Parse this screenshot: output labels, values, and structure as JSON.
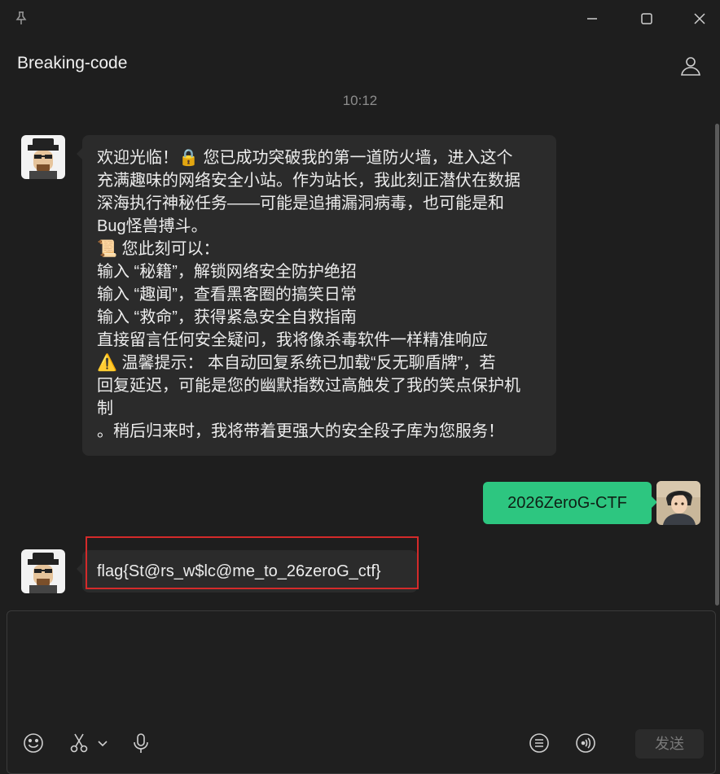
{
  "chat": {
    "title": "Breaking-code",
    "timestamp": "10:12"
  },
  "messages": {
    "bot_welcome": {
      "lines": [
        "欢迎光临！🔒 您已成功突破我的第一道防火墙，进入这个",
        "充满趣味的网络安全小站。作为站长，我此刻正潜伏在数据",
        "深海执行神秘任务——可能是追捕漏洞病毒，也可能是和",
        "Bug怪兽搏斗。",
        "📜 您此刻可以：",
        "输入 “秘籍”，解锁网络安全防护绝招",
        "输入 “趣闻”，查看黑客圈的搞笑日常",
        "输入 “救命”，获得紧急安全自救指南",
        "直接留言任何安全疑问，我将像杀毒软件一样精准响应",
        "⚠️ 温馨提示： 本自动回复系统已加载“反无聊盾牌”，若",
        "回复延迟，可能是您的幽默指数过高触发了我的笑点保护机",
        "制",
        "。稍后归来时，我将带着更强大的安全段子库为您服务！"
      ]
    },
    "user_message": "2026ZeroG-CTF",
    "bot_flag": "flag{St@rs_w$lc@me_to_26zeroG_ctf}"
  },
  "composer": {
    "send_label": "发送",
    "placeholder": ""
  },
  "icons": {
    "pin": "pin-icon",
    "minimize": "minimize-icon",
    "maximize": "maximize-icon",
    "close": "close-icon",
    "profile": "person-icon",
    "emoji": "emoji-icon",
    "scissors": "scissors-icon",
    "chevron": "chevron-down-icon",
    "mic": "microphone-icon",
    "list": "list-icon",
    "voice": "voice-icon"
  },
  "colors": {
    "background": "#1e1e1e",
    "bot_bubble": "#2b2b2b",
    "user_bubble": "#2dc680",
    "highlight": "#d42a2a"
  }
}
